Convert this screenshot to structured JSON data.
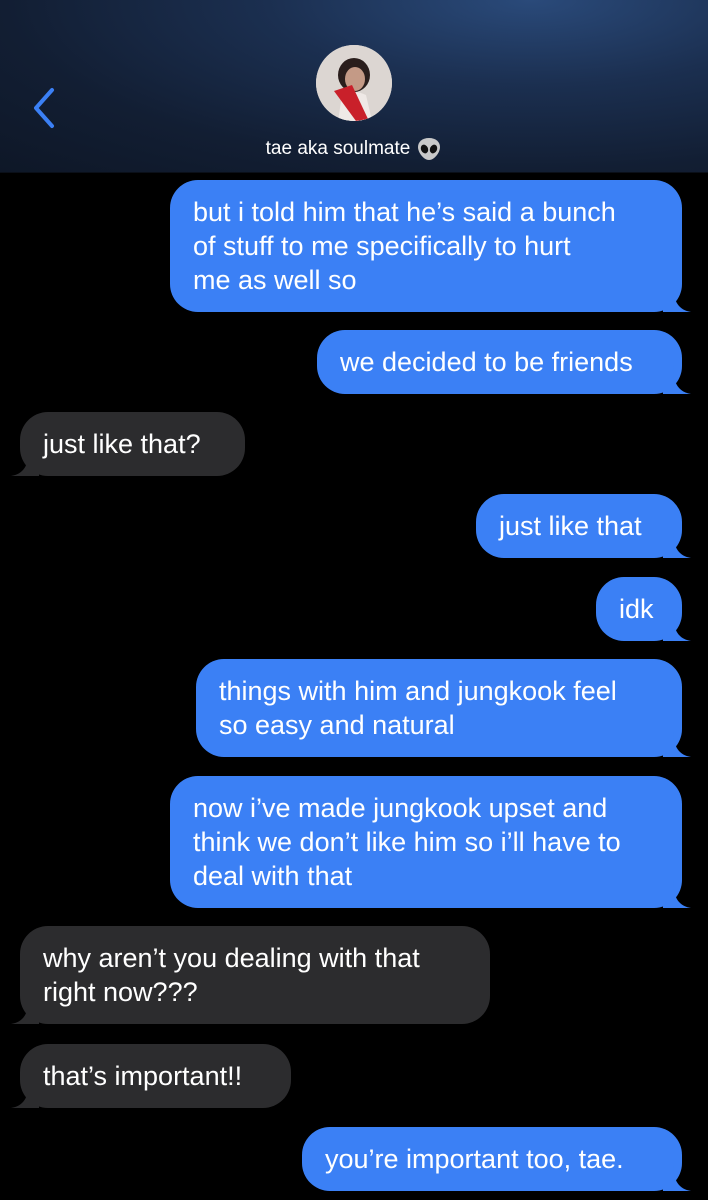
{
  "header": {
    "contact_name": "tae aka soulmate",
    "contact_emoji": "alien-face-icon"
  },
  "colors": {
    "sent_bubble": "#3b80f5",
    "received_bubble": "#2c2c2e",
    "accent": "#3b80f5",
    "background": "#000000"
  },
  "messages": [
    {
      "from": "me",
      "lines": [
        "but i told him that he’s said a bunch",
        "of stuff to me specifically to hurt",
        "me as well so"
      ]
    },
    {
      "from": "me",
      "lines": [
        "we decided to be friends"
      ]
    },
    {
      "from": "them",
      "lines": [
        "just like that?"
      ]
    },
    {
      "from": "me",
      "lines": [
        "just like that"
      ]
    },
    {
      "from": "me",
      "lines": [
        "idk"
      ]
    },
    {
      "from": "me",
      "lines": [
        "things with him and jungkook feel",
        "so easy and natural"
      ]
    },
    {
      "from": "me",
      "lines": [
        "now i’ve made jungkook upset and",
        "think we don’t like him so i’ll have to",
        "deal with that"
      ]
    },
    {
      "from": "them",
      "lines": [
        "why aren’t you dealing with that",
        "right now???"
      ]
    },
    {
      "from": "them",
      "lines": [
        "that’s important!!"
      ]
    },
    {
      "from": "me",
      "lines": [
        "you’re important too, tae."
      ]
    }
  ]
}
